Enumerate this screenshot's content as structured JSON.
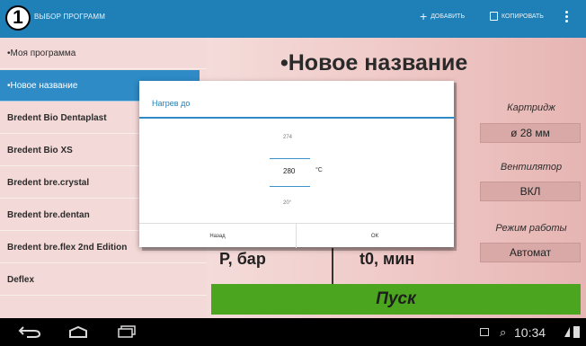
{
  "appbar": {
    "badge": "1",
    "title": "ВЫБОР ПРОГРАММ",
    "add_label": "ДОБАВИТЬ",
    "copy_label": "КОПИРОВАТЬ"
  },
  "programs": [
    {
      "label": "•Моя программа",
      "selected": false,
      "bold": true
    },
    {
      "label": "•Новое название",
      "selected": true,
      "bold": false
    },
    {
      "label": "Bredent Bio Dentaplast",
      "selected": false,
      "bold": true
    },
    {
      "label": "Bredent Bio XS",
      "selected": false,
      "bold": true
    },
    {
      "label": "Bredent bre.crystal",
      "selected": false,
      "bold": true
    },
    {
      "label": "Bredent bre.dentan",
      "selected": false,
      "bold": true
    },
    {
      "label": "Bredent bre.flex 2nd Edition",
      "selected": false,
      "bold": true
    },
    {
      "label": "Deflex",
      "selected": false,
      "bold": true
    }
  ],
  "detail": {
    "program_title": "•Новое название",
    "cartridge_label": "Картридж",
    "cartridge_value": "ø 28 мм",
    "fan_label": "Вентилятор",
    "fan_value": "ВКЛ",
    "mode_label": "Режим работы",
    "mode_value": "Автомат",
    "pressure_header": "P, бар",
    "time_header": "t0, мин",
    "start_label": "Пуск"
  },
  "dialog": {
    "title": "Нагрев до",
    "prev_value": "274",
    "current_value": "280",
    "unit": "°C",
    "next_value": "20°",
    "cancel_label": "Назад",
    "ok_label": "ОК"
  },
  "statusbar": {
    "time": "10:34"
  },
  "colors": {
    "accent": "#1f7fb7",
    "selected": "#2e8bc6",
    "start": "#4ca51f",
    "background": "#e9c9c8"
  }
}
